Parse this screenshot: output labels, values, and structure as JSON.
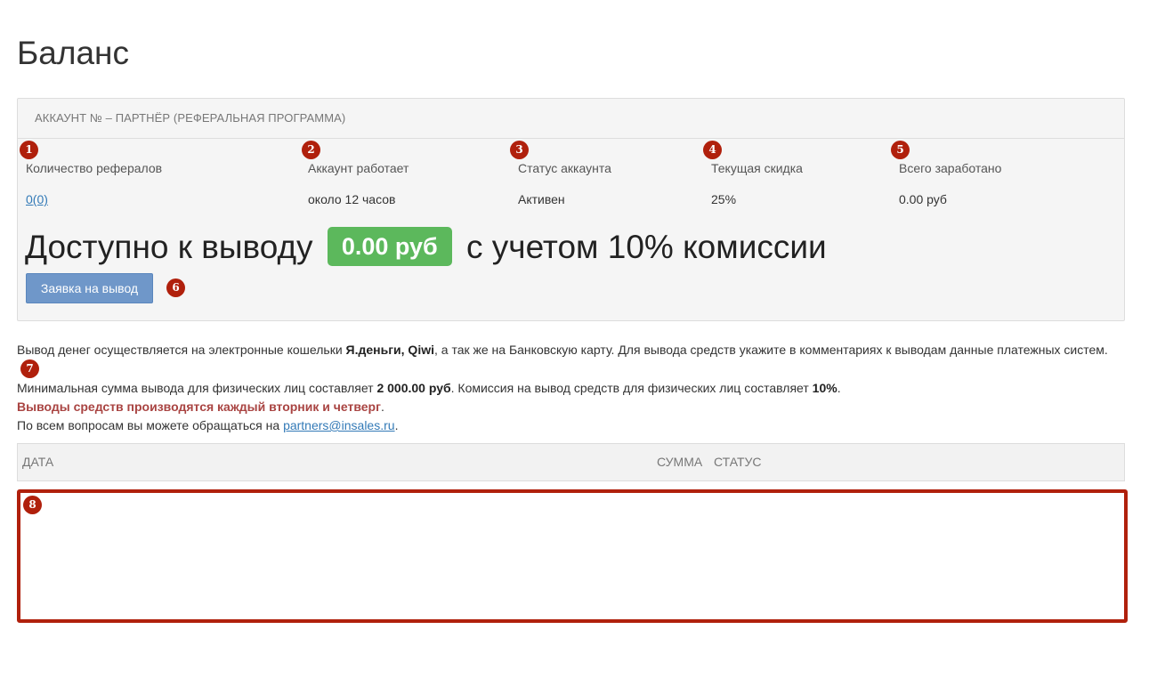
{
  "page": {
    "title": "Баланс"
  },
  "panel": {
    "heading": "АККАУНТ № – ПАРТНЁР (РЕФЕРАЛЬНАЯ ПРОГРАММА)",
    "stats": [
      {
        "badge": "1",
        "label": "Количество рефералов",
        "value_main": "0",
        "value_sub": "(0)"
      },
      {
        "badge": "2",
        "label": "Аккаунт работает",
        "value": "около 12 часов"
      },
      {
        "badge": "3",
        "label": "Статус аккаунта",
        "value": "Активен"
      },
      {
        "badge": "4",
        "label": "Текущая скидка",
        "value": "25%"
      },
      {
        "badge": "5",
        "label": "Всего заработано",
        "value": "0.00 руб"
      }
    ],
    "available": {
      "prefix": "Доступно к выводу",
      "amount": "0.00 руб",
      "suffix": "с учетом 10% комиссии"
    },
    "withdraw_button": "Заявка на вывод",
    "withdraw_badge": "6"
  },
  "info": {
    "line1_a": "Вывод денег осуществляется на электронные кошельки ",
    "line1_b": "Я.деньги, Qiwi",
    "line1_c": ", а так же на Банковскую карту. Для вывода средств укажите в комментариях к выводам данные платежных систем.",
    "line1_badge": "7",
    "line2_a": "Минимальная сумма вывода для физических лиц составляет ",
    "line2_b": "2 000.00 руб",
    "line2_c": ". Комиссия на вывод средств для физических лиц составляет ",
    "line2_d": "10%",
    "line2_e": ".",
    "line3_a": "Выводы средств производятся каждый вторник и четверг",
    "line3_b": ".",
    "line4_a": "По всем вопросам вы можете обращаться на ",
    "line4_link": "partners@insales.ru",
    "line4_b": "."
  },
  "table": {
    "columns": {
      "date": "ДАТА",
      "sum": "СУММА",
      "status": "СТАТУС"
    },
    "body_badge": "8"
  },
  "colors": {
    "badge": "#b0200c",
    "amount_pill": "#5cb85c",
    "button": "#6f97c9",
    "warning_text": "#a94442",
    "link": "#337ab7"
  }
}
